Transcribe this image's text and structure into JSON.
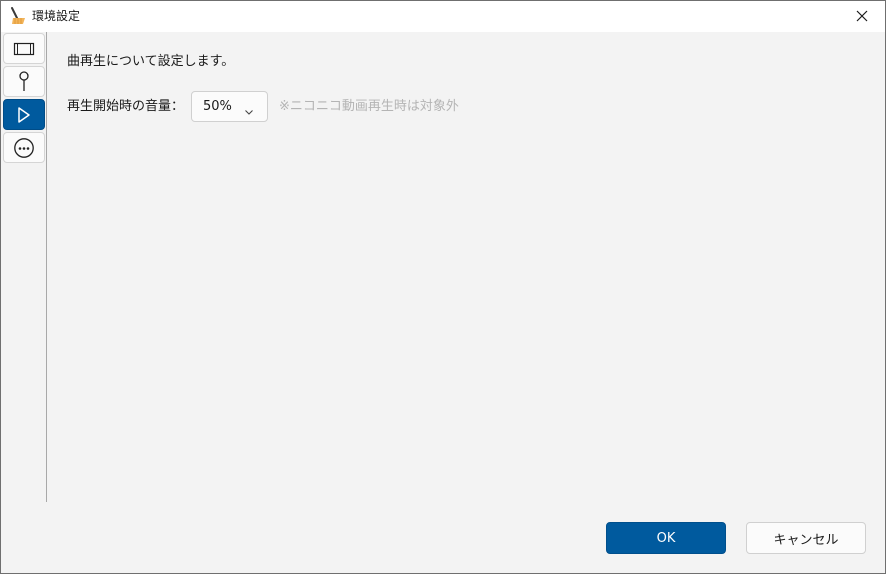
{
  "window": {
    "title": "環境設定",
    "close_glyph": "✕"
  },
  "sidebar": {
    "items": [
      {
        "name": "film-icon",
        "active": false
      },
      {
        "name": "pin-icon",
        "active": false
      },
      {
        "name": "play-icon",
        "active": true
      },
      {
        "name": "more-icon",
        "active": false
      }
    ]
  },
  "playback": {
    "description": "曲再生について設定します。",
    "volume_label": "再生開始時の音量：",
    "volume_value": "50%",
    "note": "※ニコニコ動画再生時は対象外"
  },
  "footer": {
    "ok_label": "OK",
    "cancel_label": "キャンセル"
  },
  "colors": {
    "accent": "#005a9e",
    "background": "#f3f3f3",
    "muted_text": "#b4b4b4"
  }
}
